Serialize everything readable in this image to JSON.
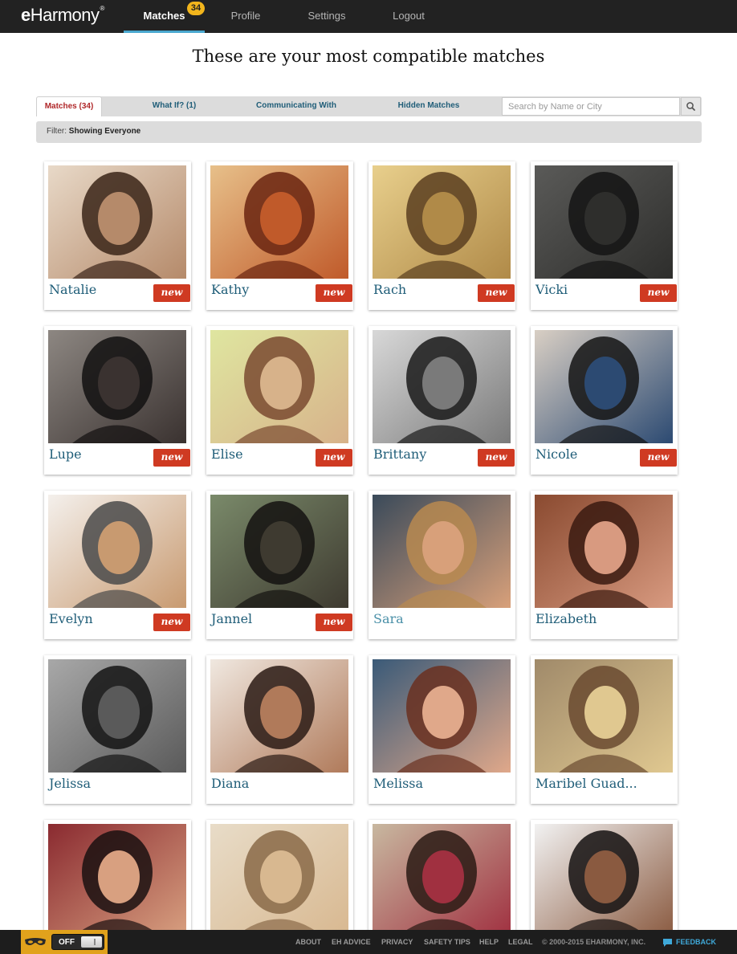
{
  "brand": {
    "logo_e": "e",
    "logo_rest": "Harmony",
    "logo_mark": "®"
  },
  "nav": {
    "matches": "Matches",
    "matches_badge": "34",
    "profile": "Profile",
    "settings": "Settings",
    "logout": "Logout"
  },
  "page": {
    "title": "These are your most compatible matches"
  },
  "tabs": {
    "matches": "Matches (34)",
    "what_if": "What If? (1)",
    "communicating": "Communicating With",
    "hidden": "Hidden Matches"
  },
  "search": {
    "placeholder": "Search by Name or City"
  },
  "filter": {
    "label": "Filter:",
    "value": "Showing Everyone"
  },
  "new_label": "new",
  "matches": [
    {
      "name": "Natalie",
      "is_new": true,
      "tone": [
        "#e8d9c8",
        "#b58a6a",
        "#3a2418"
      ]
    },
    {
      "name": "Kathy",
      "is_new": true,
      "tone": [
        "#e7c08a",
        "#c05a2a",
        "#6a2410"
      ]
    },
    {
      "name": "Rach",
      "is_new": true,
      "tone": [
        "#e8cf8c",
        "#b08a48",
        "#5a3e20"
      ]
    },
    {
      "name": "Vicki",
      "is_new": true,
      "tone": [
        "#5a5a58",
        "#2e2e2c",
        "#141414"
      ]
    },
    {
      "name": "Lupe",
      "is_new": true,
      "tone": [
        "#8d8782",
        "#3a3230",
        "#121010"
      ]
    },
    {
      "name": "Elise",
      "is_new": true,
      "tone": [
        "#dfe6a0",
        "#d7b28a",
        "#7a4a30"
      ]
    },
    {
      "name": "Brittany",
      "is_new": true,
      "tone": [
        "#d8d8d8",
        "#7a7a7a",
        "#1a1a1a"
      ]
    },
    {
      "name": "Nicole",
      "is_new": true,
      "tone": [
        "#d9cfc4",
        "#2c4a72",
        "#141414"
      ]
    },
    {
      "name": "Evelyn",
      "is_new": true,
      "tone": [
        "#f4f0ec",
        "#c89a70",
        "#4a4a4a"
      ]
    },
    {
      "name": "Jannel",
      "is_new": true,
      "tone": [
        "#7a8a6a",
        "#3e3a30",
        "#141210"
      ]
    },
    {
      "name": "Sara",
      "is_new": false,
      "light": true,
      "tone": [
        "#3a4a5a",
        "#d8a07a",
        "#b88a50"
      ]
    },
    {
      "name": "Elizabeth",
      "is_new": false,
      "tone": [
        "#8a4a30",
        "#d89a80",
        "#3a1a10"
      ]
    },
    {
      "name": "Jelissa",
      "is_new": false,
      "tone": [
        "#a8a8a8",
        "#5a5a5a",
        "#141414"
      ]
    },
    {
      "name": "Diana",
      "is_new": false,
      "tone": [
        "#f0e8e0",
        "#b07a5a",
        "#2a1a14"
      ]
    },
    {
      "name": "Melissa",
      "is_new": false,
      "tone": [
        "#3a5a78",
        "#e0a88a",
        "#6a3020"
      ]
    },
    {
      "name": "Maribel Guad...",
      "is_new": false,
      "tone": [
        "#a08a6a",
        "#e0c890",
        "#6a4a30"
      ]
    },
    {
      "name": "",
      "is_new": false,
      "tone": [
        "#8a2a30",
        "#d8a080",
        "#1a1010"
      ]
    },
    {
      "name": "",
      "is_new": false,
      "tone": [
        "#e8dcc8",
        "#d8b890",
        "#8a6a48"
      ]
    },
    {
      "name": "",
      "is_new": false,
      "tone": [
        "#c8b8a0",
        "#a03040",
        "#2a1a14"
      ]
    },
    {
      "name": "",
      "is_new": false,
      "tone": [
        "#f2f2f2",
        "#8a5a40",
        "#141010"
      ]
    }
  ],
  "footer": {
    "privacy_toggle": "OFF",
    "links": [
      "ABOUT",
      "EH ADVICE",
      "PRIVACY",
      "SAFETY TIPS",
      "HELP",
      "LEGAL"
    ],
    "copyright": "© 2000-2015 EHARMONY, INC.",
    "feedback": "FEEDBACK"
  },
  "colors": {
    "topbar": "#222222",
    "accent": "#4aa8cf",
    "badge": "#f2b51c",
    "name_text": "#1f5d78",
    "new_badge": "#cf3a22",
    "active_tab_text": "#b0282a",
    "privacy_bar": "#e1a21c",
    "feedback": "#3fa9d9"
  }
}
